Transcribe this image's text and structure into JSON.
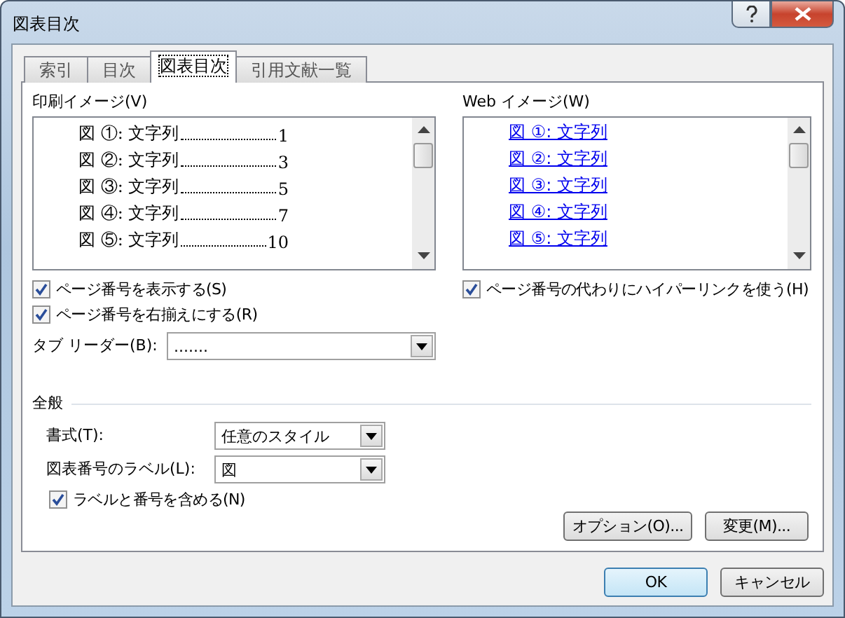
{
  "window": {
    "title": "図表目次"
  },
  "tabs": [
    {
      "label": "索引",
      "selected": false
    },
    {
      "label": "目次",
      "selected": false
    },
    {
      "label": "図表目次",
      "selected": true
    },
    {
      "label": "引用文献一覧",
      "selected": false
    }
  ],
  "print_preview": {
    "label": "印刷イメージ(V)",
    "entries": [
      {
        "caption": "図 ①: 文字列",
        "page": "1"
      },
      {
        "caption": "図 ②: 文字列",
        "page": "3"
      },
      {
        "caption": "図 ③: 文字列",
        "page": "5"
      },
      {
        "caption": "図 ④: 文字列",
        "page": "7"
      },
      {
        "caption": "図 ⑤: 文字列",
        "page": "10"
      }
    ]
  },
  "print_options": [
    {
      "label": "ページ番号を表示する(S)",
      "checked": true
    },
    {
      "label": "ページ番号を右揃えにする(R)",
      "checked": true
    }
  ],
  "tab_leader": {
    "label": "タブ リーダー(B):",
    "value": "......."
  },
  "web_preview": {
    "label": "Web イメージ(W)",
    "entries": [
      "図 ①: 文字列",
      "図 ②: 文字列",
      "図 ③: 文字列",
      "図 ④: 文字列",
      "図 ⑤: 文字列"
    ]
  },
  "web_options": [
    {
      "label": "ページ番号の代わりにハイパーリンクを使う(H)",
      "checked": true
    }
  ],
  "general": {
    "title": "全般",
    "fields": [
      {
        "label": "書式(T):",
        "value": "任意のスタイル"
      },
      {
        "label": "図表番号のラベル(L):",
        "value": "図"
      }
    ],
    "options": [
      {
        "label": "ラベルと番号を含める(N)",
        "checked": true
      }
    ],
    "buttons": [
      "オプション(O)...",
      "変更(M)..."
    ]
  },
  "footer_buttons": [
    {
      "label": "OK",
      "default": true
    },
    {
      "label": "キャンセル",
      "default": false
    }
  ]
}
